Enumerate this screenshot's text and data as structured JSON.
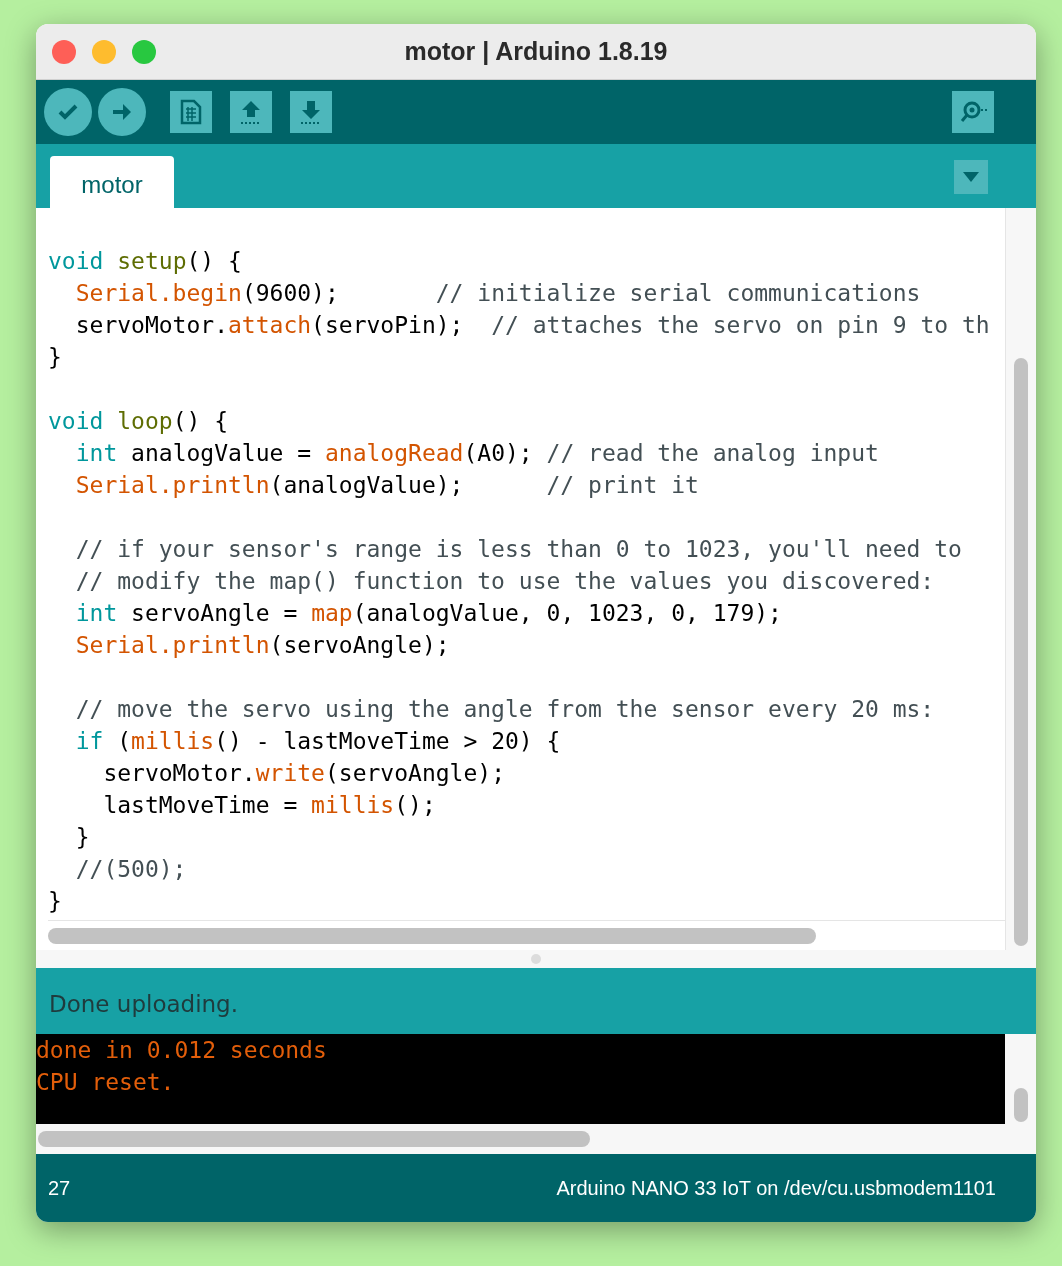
{
  "window": {
    "title": "motor | Arduino 1.8.19"
  },
  "toolbar": {
    "buttons": [
      {
        "kind": "verify"
      },
      {
        "kind": "upload"
      },
      {
        "kind": "new"
      },
      {
        "kind": "open"
      },
      {
        "kind": "save"
      }
    ]
  },
  "tabs": [
    {
      "label": "motor",
      "selected": true
    }
  ],
  "code": {
    "lines": [
      {
        "kind": "blank"
      },
      {
        "kind": "code",
        "tokens": [
          {
            "kind": "keyword",
            "text": "void"
          },
          {
            "kind": "function",
            "text": " setup"
          },
          {
            "kind": "plain",
            "text": "() {"
          }
        ]
      },
      {
        "kind": "code",
        "tokens": [
          {
            "kind": "builtin",
            "text": "  Serial.begin"
          },
          {
            "kind": "plain",
            "text": "(9600);       "
          },
          {
            "kind": "comment",
            "text": "// initialize serial communications"
          }
        ]
      },
      {
        "kind": "code",
        "tokens": [
          {
            "kind": "plain",
            "text": "  servoMotor."
          },
          {
            "kind": "builtin",
            "text": "attach"
          },
          {
            "kind": "plain",
            "text": "(servoPin);  "
          },
          {
            "kind": "comment",
            "text": "// attaches the servo on pin 9 to th"
          }
        ]
      },
      {
        "kind": "code",
        "tokens": [
          {
            "kind": "plain",
            "text": "}"
          }
        ]
      },
      {
        "kind": "blank"
      },
      {
        "kind": "code",
        "tokens": [
          {
            "kind": "keyword",
            "text": "void"
          },
          {
            "kind": "function",
            "text": " loop"
          },
          {
            "kind": "plain",
            "text": "() {"
          }
        ]
      },
      {
        "kind": "code",
        "tokens": [
          {
            "kind": "keyword",
            "text": "  int"
          },
          {
            "kind": "plain",
            "text": " analogValue = "
          },
          {
            "kind": "builtin",
            "text": "analogRead"
          },
          {
            "kind": "plain",
            "text": "(A0); "
          },
          {
            "kind": "comment",
            "text": "// read the analog input"
          }
        ]
      },
      {
        "kind": "code",
        "tokens": [
          {
            "kind": "builtin",
            "text": "  Serial.println"
          },
          {
            "kind": "plain",
            "text": "(analogValue);      "
          },
          {
            "kind": "comment",
            "text": "// print it"
          }
        ]
      },
      {
        "kind": "blank"
      },
      {
        "kind": "code",
        "tokens": [
          {
            "kind": "comment",
            "text": "  // if your sensor's range is less than 0 to 1023, you'll need to"
          }
        ]
      },
      {
        "kind": "code",
        "tokens": [
          {
            "kind": "comment",
            "text": "  // modify the map() function to use the values you discovered:"
          }
        ]
      },
      {
        "kind": "code",
        "tokens": [
          {
            "kind": "keyword",
            "text": "  int"
          },
          {
            "kind": "plain",
            "text": " servoAngle = "
          },
          {
            "kind": "builtin",
            "text": "map"
          },
          {
            "kind": "plain",
            "text": "(analogValue, 0, 1023, 0, 179);"
          }
        ]
      },
      {
        "kind": "code",
        "tokens": [
          {
            "kind": "builtin",
            "text": "  Serial.println"
          },
          {
            "kind": "plain",
            "text": "(servoAngle);"
          }
        ]
      },
      {
        "kind": "blank"
      },
      {
        "kind": "code",
        "tokens": [
          {
            "kind": "comment",
            "text": "  // move the servo using the angle from the sensor every 20 ms:"
          }
        ]
      },
      {
        "kind": "code",
        "tokens": [
          {
            "kind": "keyword",
            "text": "  if"
          },
          {
            "kind": "plain",
            "text": " ("
          },
          {
            "kind": "builtin",
            "text": "millis"
          },
          {
            "kind": "plain",
            "text": "() - lastMoveTime > 20) {"
          }
        ]
      },
      {
        "kind": "code",
        "tokens": [
          {
            "kind": "plain",
            "text": "    servoMotor."
          },
          {
            "kind": "builtin",
            "text": "write"
          },
          {
            "kind": "plain",
            "text": "(servoAngle);"
          }
        ]
      },
      {
        "kind": "code",
        "tokens": [
          {
            "kind": "plain",
            "text": "    lastMoveTime = "
          },
          {
            "kind": "builtin",
            "text": "millis"
          },
          {
            "kind": "plain",
            "text": "();"
          }
        ]
      },
      {
        "kind": "code",
        "tokens": [
          {
            "kind": "plain",
            "text": "  }"
          }
        ]
      },
      {
        "kind": "code",
        "tokens": [
          {
            "kind": "comment",
            "text": "  //(500);"
          }
        ]
      },
      {
        "kind": "code",
        "tokens": [
          {
            "kind": "plain",
            "text": "}"
          }
        ]
      }
    ]
  },
  "message": "Done uploading.",
  "console": {
    "lines": [
      "done in 0.012 seconds",
      "CPU reset."
    ]
  },
  "status_bar": {
    "line": "27",
    "board": "Arduino NANO 33 IoT on /dev/cu.usbmodem1101"
  }
}
